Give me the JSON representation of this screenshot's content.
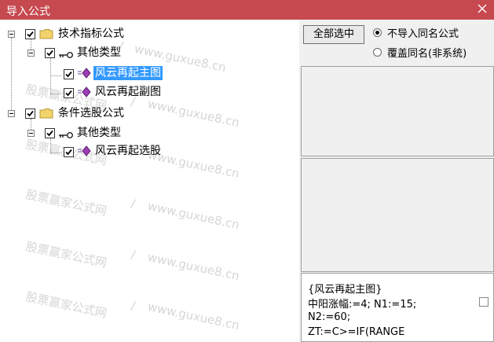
{
  "window": {
    "title": "导入公式"
  },
  "tree": {
    "groups": [
      {
        "label": "技术指标公式",
        "type_label": "其他类型",
        "items": [
          {
            "label": "风云再起主图",
            "selected": true
          },
          {
            "label": "风云再起副图",
            "selected": false
          }
        ]
      },
      {
        "label": "条件选股公式",
        "type_label": "其他类型",
        "items": [
          {
            "label": "风云再起选股",
            "selected": false
          }
        ]
      }
    ]
  },
  "watermark": {
    "site": "www.guxue8.cn",
    "brand": "股票赢家公式网",
    "sep": "/"
  },
  "options": {
    "select_all_label": "全部选中",
    "radio_no_import": "不导入同名公式",
    "radio_overwrite": "覆盖同名(非系统)",
    "selected": "radio_no_import"
  },
  "code_preview": {
    "lines": [
      "{风云再起主图}",
      "中阳涨幅:=4;  N1:=15;",
      "N2:=60;",
      "ZT:=C>=IF(RANGE"
    ]
  },
  "colors": {
    "titlebar": "#c6494f",
    "selection": "#3399ff",
    "pane": "#f0f0f0"
  }
}
